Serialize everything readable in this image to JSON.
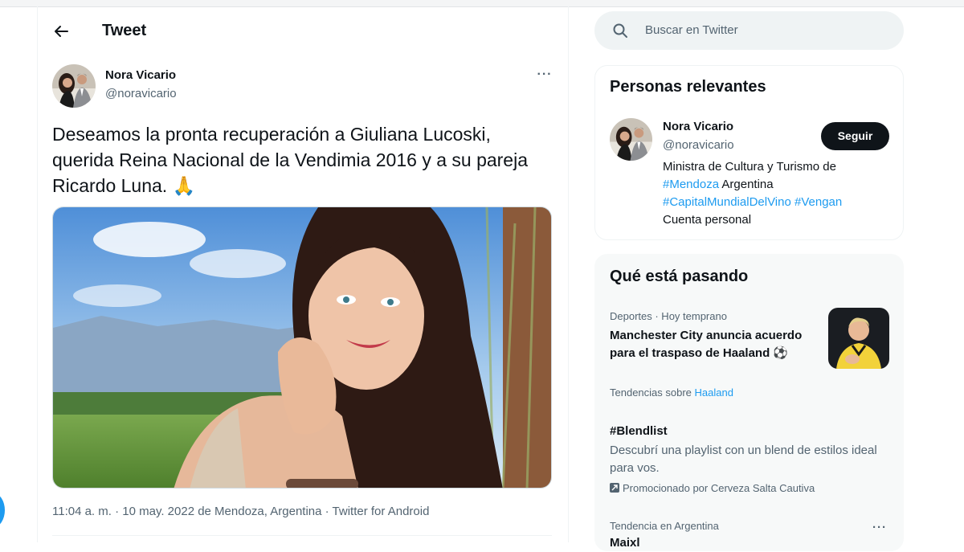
{
  "header": {
    "title": "Tweet"
  },
  "tweet": {
    "author_name": "Nora Vicario",
    "author_handle": "@noravicario",
    "more_glyph": "···",
    "text": "Deseamos la pronta recuperación a Giuliana Lucoski, querida Reina Nacional de la Vendimia 2016 y a su pareja Ricardo Luna. 🙏",
    "meta": "11:04 a. m. · 10 may. 2022 de Mendoza, Argentina · Twitter for Android"
  },
  "search": {
    "placeholder": "Buscar en Twitter"
  },
  "relevant": {
    "title": "Personas relevantes",
    "name": "Nora Vicario",
    "handle": "@noravicario",
    "follow_label": "Seguir",
    "bio_line1": "Ministra de Cultura y Turismo de",
    "bio_tag1": "#Mendoza",
    "bio_word": " Argentina",
    "bio_tag2": "#CapitalMundialDelVino",
    "bio_tag3": "#Vengan",
    "bio_line4": "Cuenta personal"
  },
  "trends": {
    "title": "Qué está pasando",
    "items": [
      {
        "meta": "Deportes · Hoy temprano",
        "headline": "Manchester City anuncia acuerdo para el traspaso de Haaland ⚽",
        "footer_prefix": "Tendencias sobre ",
        "footer_link": "Haaland"
      },
      {
        "headline": "#Blendlist",
        "body": "Descubrí una playlist con un blend de estilos ideal para vos.",
        "promo": "Promocionado por Cerveza Salta Cautiva"
      },
      {
        "meta": "Tendencia en Argentina",
        "headline": "Maixl",
        "more_glyph": "···"
      }
    ]
  },
  "colors": {
    "accent": "#1d9bf0",
    "text": "#0f1419",
    "muted": "#536471",
    "surface": "#f7f9f9"
  }
}
